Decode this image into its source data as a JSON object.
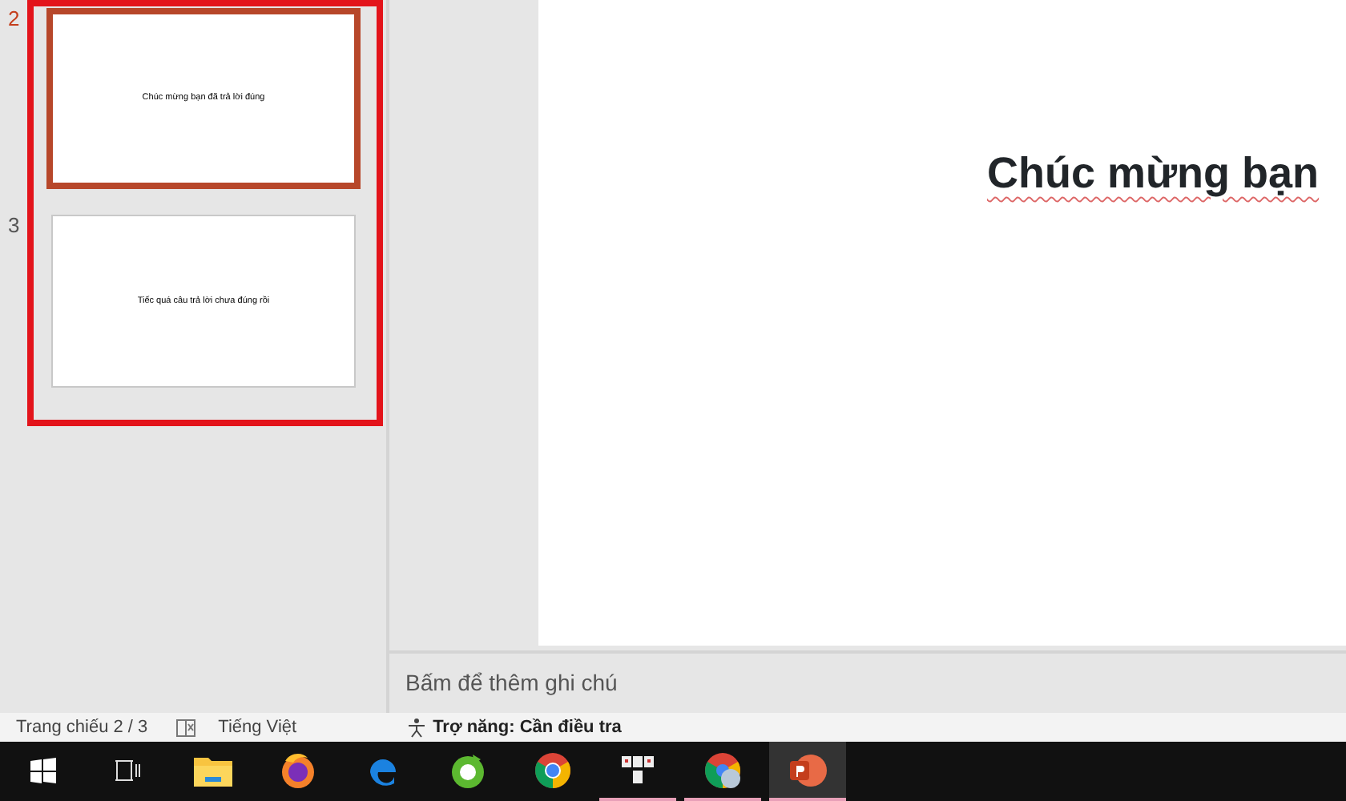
{
  "slides": [
    {
      "number": "2",
      "text": "Chúc mừng bạn đã trả lời đúng",
      "selected": true
    },
    {
      "number": "3",
      "text": "Tiếc quá câu trả lời chưa đúng rồi",
      "selected": false
    }
  ],
  "annotation": {
    "kind": "highlight-frame",
    "color": "#e3141b"
  },
  "current_slide": {
    "title": "Chúc mừng bạn"
  },
  "notes": {
    "placeholder": "Bấm để thêm ghi chú"
  },
  "status_bar": {
    "slide_counter": "Trang chiếu 2 / 3",
    "language": "Tiếng Việt",
    "accessibility": "Trợ năng: Cần điều tra"
  },
  "taskbar": [
    {
      "kind": "start",
      "running": false,
      "selected": false
    },
    {
      "kind": "taskview",
      "running": false,
      "selected": false
    },
    {
      "kind": "explorer",
      "running": false,
      "selected": false
    },
    {
      "kind": "firefox",
      "running": false,
      "selected": false
    },
    {
      "kind": "edge",
      "running": false,
      "selected": false
    },
    {
      "kind": "coccoc",
      "running": false,
      "selected": false
    },
    {
      "kind": "chrome",
      "running": false,
      "selected": false
    },
    {
      "kind": "app",
      "running": true,
      "selected": false
    },
    {
      "kind": "chrome-profile",
      "running": true,
      "selected": false
    },
    {
      "kind": "powerpoint",
      "running": true,
      "selected": true
    }
  ]
}
